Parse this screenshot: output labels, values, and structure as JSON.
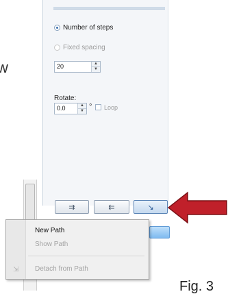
{
  "background": {
    "side_letter": "w"
  },
  "panel": {
    "distribution_options": [
      {
        "label": "Number of steps",
        "selected": true,
        "enabled": true
      },
      {
        "label": "Fixed spacing",
        "selected": false,
        "enabled": false
      }
    ],
    "steps_value": "20",
    "rotate_label": "Rotate:",
    "rotate_value": "0.0",
    "degree_symbol": "°",
    "loop_label": "Loop",
    "loop_checked": false
  },
  "path_buttons": [
    {
      "icon": "arrow-right-icon",
      "glyph": "⇉"
    },
    {
      "icon": "arrow-left-icon",
      "glyph": "⇇"
    },
    {
      "icon": "path-curve-icon",
      "glyph": "↘"
    }
  ],
  "context_menu": {
    "items": [
      {
        "label": "New Path",
        "enabled": true
      },
      {
        "label": "Show Path",
        "enabled": false
      },
      {
        "label": "Detach from Path",
        "enabled": false
      }
    ],
    "detach_icon_glyph": "⇲"
  },
  "annotation": {
    "arrow_color": "#c0202a",
    "caption": "Fig. 3"
  }
}
